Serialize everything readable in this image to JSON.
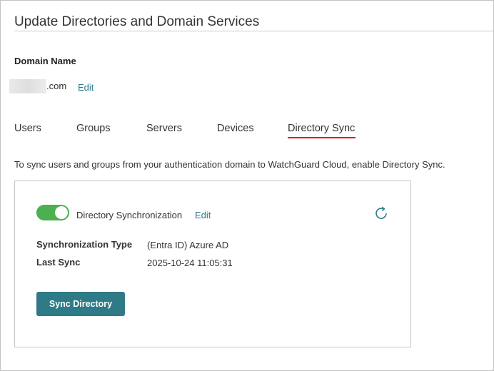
{
  "page": {
    "title": "Update Directories and Domain Services"
  },
  "domain": {
    "label": "Domain Name",
    "suffix": ".com",
    "edit_label": "Edit"
  },
  "tabs": [
    {
      "label": "Users"
    },
    {
      "label": "Groups"
    },
    {
      "label": "Servers"
    },
    {
      "label": "Devices"
    },
    {
      "label": "Directory Sync",
      "active": true
    }
  ],
  "sync": {
    "intro": "To sync users and groups from your authentication domain to WatchGuard Cloud, enable Directory Sync.",
    "toggle_label": "Directory Synchronization",
    "toggle_on": true,
    "edit_label": "Edit",
    "refresh_icon": "refresh-icon",
    "fields": [
      {
        "label": "Synchronization Type",
        "value": "(Entra ID) Azure AD"
      },
      {
        "label": "Last Sync",
        "value": "2025-10-24 11:05:31"
      }
    ],
    "button_label": "Sync Directory"
  },
  "colors": {
    "accent": "#2a7a8c",
    "button": "#2f7a87",
    "toggle_on": "#4caf50",
    "active_tab_underline": "#e31b23"
  }
}
